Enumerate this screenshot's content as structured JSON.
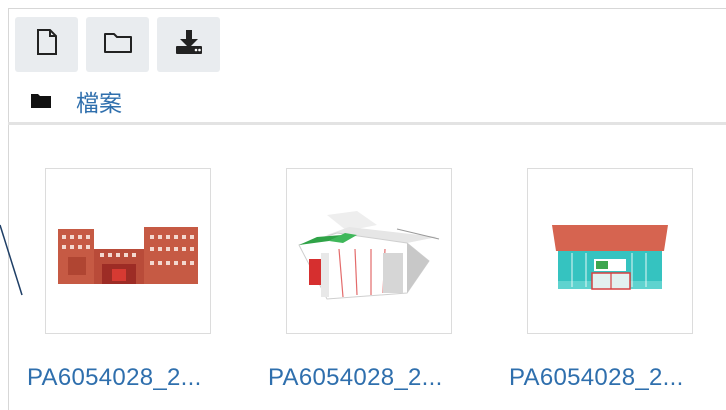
{
  "toolbar": {
    "new_file_icon": "new-file-icon",
    "new_folder_icon": "new-folder-icon",
    "download_icon": "download-icon"
  },
  "path": {
    "folder_icon": "folder-icon",
    "label": "檔案"
  },
  "files": [
    {
      "name": "PA6054028_2...",
      "thumbnail": "red-brick-building"
    },
    {
      "name": "PA6054028_2...",
      "thumbnail": "white-canopy-building"
    },
    {
      "name": "PA6054028_2...",
      "thumbnail": "storefront-building"
    }
  ],
  "colors": {
    "link": "#2f6fad",
    "toolbar_button_bg": "#e9ecef",
    "border": "#dcdcdc"
  }
}
